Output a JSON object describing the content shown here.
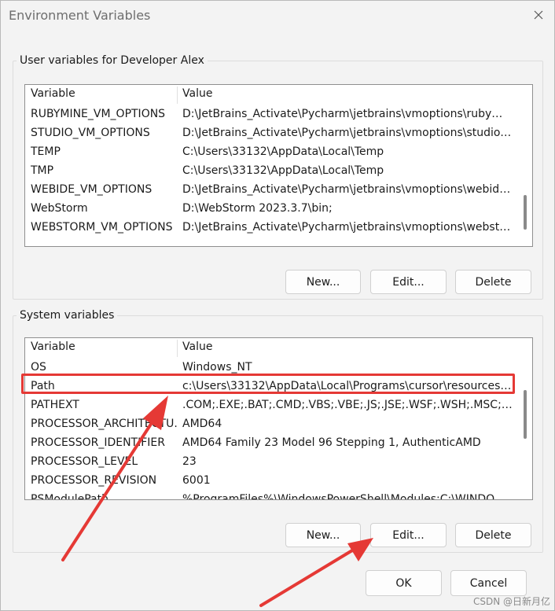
{
  "window": {
    "title": "Environment Variables"
  },
  "user_group": {
    "legend": "User variables for Developer Alex",
    "columns": {
      "variable": "Variable",
      "value": "Value"
    },
    "rows": [
      {
        "name": "RUBYMINE_VM_OPTIONS",
        "value": "D:\\JetBrains_Activate\\Pycharm\\jetbrains\\vmoptions\\rubymine..."
      },
      {
        "name": "STUDIO_VM_OPTIONS",
        "value": "D:\\JetBrains_Activate\\Pycharm\\jetbrains\\vmoptions\\studio.vm..."
      },
      {
        "name": "TEMP",
        "value": "C:\\Users\\33132\\AppData\\Local\\Temp"
      },
      {
        "name": "TMP",
        "value": "C:\\Users\\33132\\AppData\\Local\\Temp"
      },
      {
        "name": "WEBIDE_VM_OPTIONS",
        "value": "D:\\JetBrains_Activate\\Pycharm\\jetbrains\\vmoptions\\webide.v..."
      },
      {
        "name": "WebStorm",
        "value": "D:\\WebStorm 2023.3.7\\bin;"
      },
      {
        "name": "WEBSTORM_VM_OPTIONS",
        "value": "D:\\JetBrains_Activate\\Pycharm\\jetbrains\\vmoptions\\webstor..."
      }
    ],
    "buttons": {
      "new": "New...",
      "edit": "Edit...",
      "delete": "Delete"
    }
  },
  "system_group": {
    "legend": "System variables",
    "columns": {
      "variable": "Variable",
      "value": "Value"
    },
    "rows": [
      {
        "name": "OS",
        "value": "Windows_NT"
      },
      {
        "name": "Path",
        "value": "c:\\Users\\33132\\AppData\\Local\\Programs\\cursor\\resources\\a..."
      },
      {
        "name": "PATHEXT",
        "value": ".COM;.EXE;.BAT;.CMD;.VBS;.VBE;.JS;.JSE;.WSF;.WSH;.MSC;.PY;.PYW"
      },
      {
        "name": "PROCESSOR_ARCHITECTU...",
        "value": "AMD64"
      },
      {
        "name": "PROCESSOR_IDENTIFIER",
        "value": "AMD64 Family 23 Model 96 Stepping 1, AuthenticAMD"
      },
      {
        "name": "PROCESSOR_LEVEL",
        "value": "23"
      },
      {
        "name": "PROCESSOR_REVISION",
        "value": "6001"
      },
      {
        "name": "PSModulePath",
        "value": "%ProgramFiles%\\WindowsPowerShell\\Modules;C:\\WINDOWS..."
      }
    ],
    "buttons": {
      "new": "New...",
      "edit": "Edit...",
      "delete": "Delete"
    }
  },
  "footer": {
    "ok": "OK",
    "cancel": "Cancel"
  },
  "annotation": {
    "color": "#e53935",
    "highlighted_row": "Path"
  },
  "watermark": "CSDN @日新月亿"
}
